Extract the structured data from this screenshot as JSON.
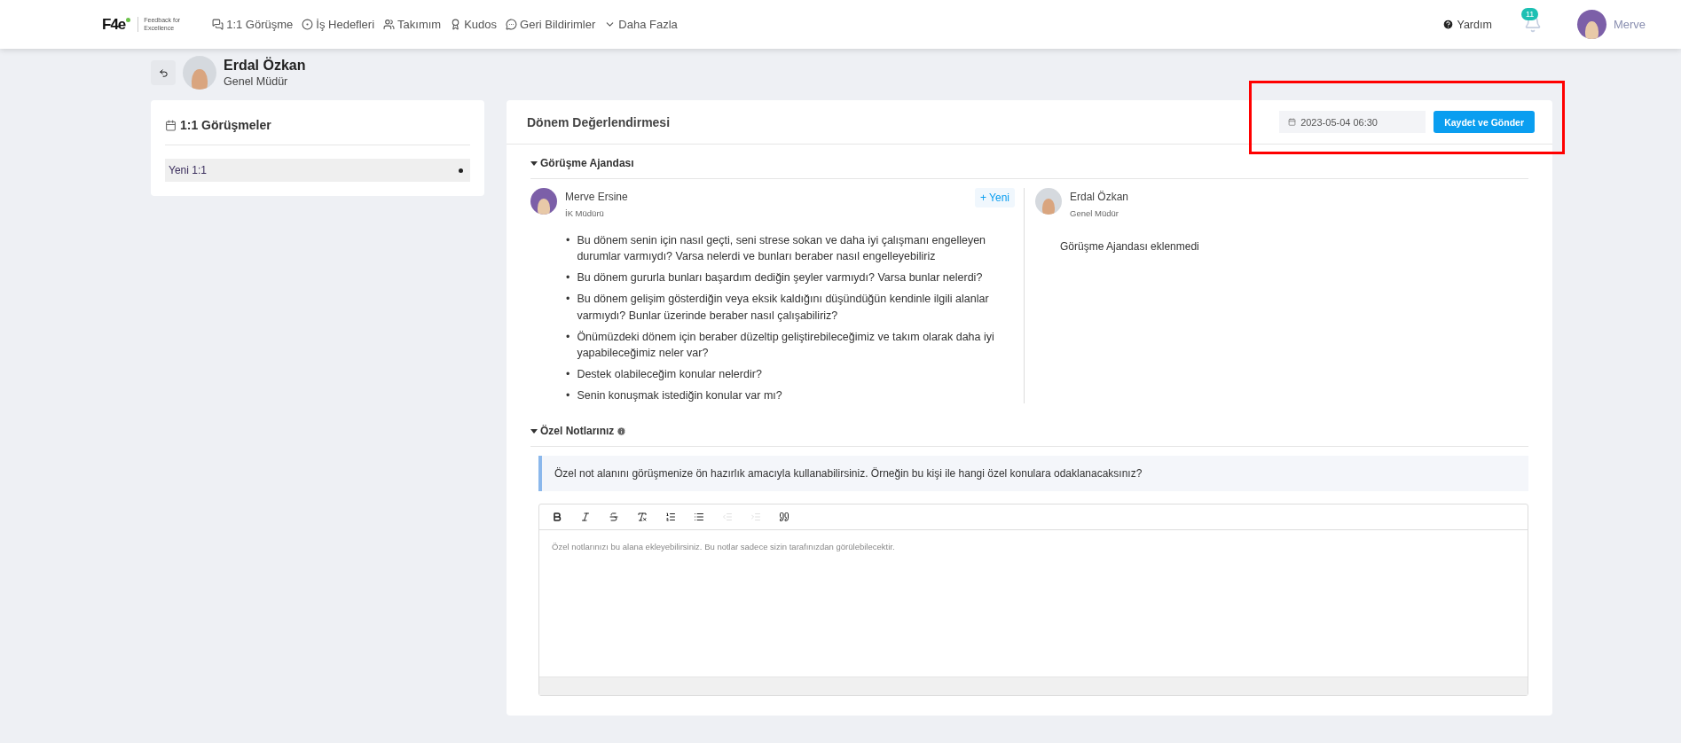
{
  "header": {
    "logo": {
      "mark": "F4e",
      "tagline_1": "Feedback for",
      "tagline_2": "Excellence"
    },
    "nav": [
      {
        "label": "1:1 Görüşme"
      },
      {
        "label": "İş Hedefleri"
      },
      {
        "label": "Takımım"
      },
      {
        "label": "Kudos"
      },
      {
        "label": "Geri Bildirimler"
      },
      {
        "label": "Daha Fazla"
      }
    ],
    "help": "Yardım",
    "notifications": "11",
    "user": "Merve"
  },
  "person": {
    "name": "Erdal Özkan",
    "title": "Genel Müdür"
  },
  "sidebar": {
    "title": "1:1 Görüşmeler",
    "items": [
      {
        "label": "Yeni 1:1",
        "selected": true
      }
    ]
  },
  "review": {
    "title": "Dönem Değerlendirmesi",
    "date": "2023-05-04 06:30",
    "submit": "Kaydet ve Gönder",
    "highlighted": true,
    "agenda": {
      "heading": "Görüşme Ajandası",
      "expanded": true,
      "columns": [
        {
          "name": "Merve Ersine",
          "role": "İK Müdürü",
          "add_button": "+ Yeni",
          "marker": "•",
          "questions": [
            "Bu dönem senin için nasıl geçti, seni strese sokan ve daha iyi çalışmanı engelleyen durumlar varmıydı? Varsa nelerdi ve bunları beraber nasıl engelleyebiliriz",
            "Bu dönem gururla bunları başardım dediğin şeyler varmıydı? Varsa bunlar nelerdi?",
            "Bu dönem gelişim gösterdiğin veya eksik kaldığını düşündüğün kendinle ilgili alanlar varmıydı? Bunlar üzerinde beraber nasıl çalışabiliriz?",
            "Önümüzdeki dönem için beraber düzeltip geliştirebileceğimiz ve takım olarak daha iyi yapabileceğimiz neler var?",
            "Destek olabileceğim konular nelerdir?",
            "Senin konuşmak istediğin konular var mı?"
          ]
        },
        {
          "name": "Erdal Özkan",
          "role": "Genel Müdür",
          "empty_text": "Görüşme Ajandası eklenmedi"
        }
      ]
    },
    "notes": {
      "heading": "Özel Notlarınız",
      "expanded": true,
      "info": "Özel not alanını görüşmenize ön hazırlık amacıyla kullanabilirsiniz. Örneğin bu kişi ile hangi özel konulara odaklanacaksınız?",
      "toolbar": [
        {
          "kind": "bold",
          "disabled": false
        },
        {
          "kind": "italic",
          "disabled": false
        },
        {
          "kind": "strike",
          "disabled": false
        },
        {
          "kind": "clear",
          "disabled": false
        },
        {
          "kind": "ordered",
          "disabled": false
        },
        {
          "kind": "bullet",
          "disabled": false
        },
        {
          "kind": "outdent",
          "disabled": true
        },
        {
          "kind": "indent",
          "disabled": true
        },
        {
          "kind": "quote",
          "disabled": false
        }
      ],
      "placeholder": "Özel notlarınızı bu alana ekleyebilirsiniz. Bu notlar sadece sizin tarafınızdan görülebilecektir."
    }
  }
}
